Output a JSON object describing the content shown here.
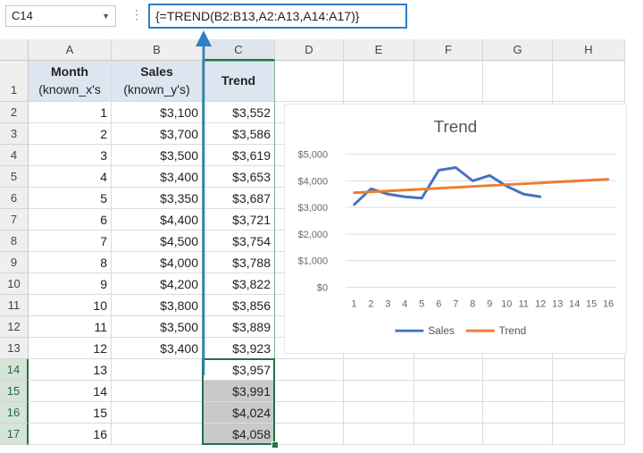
{
  "name_box": {
    "value": "C14"
  },
  "formula_bar": {
    "separator": "⋮",
    "formula": "{=TREND(B2:B13,A2:A13,A14:A17)}"
  },
  "columns": [
    "A",
    "B",
    "C",
    "D",
    "E",
    "F",
    "G",
    "H"
  ],
  "headers": {
    "month": "Month",
    "month_sub": "(known_x's",
    "sales": "Sales",
    "sales_sub": "(known_y's)",
    "trend": "Trend"
  },
  "rows": [
    {
      "row": "2",
      "month": "1",
      "sales": "$3,100",
      "trend": "$3,552"
    },
    {
      "row": "3",
      "month": "2",
      "sales": "$3,700",
      "trend": "$3,586"
    },
    {
      "row": "4",
      "month": "3",
      "sales": "$3,500",
      "trend": "$3,619"
    },
    {
      "row": "5",
      "month": "4",
      "sales": "$3,400",
      "trend": "$3,653"
    },
    {
      "row": "6",
      "month": "5",
      "sales": "$3,350",
      "trend": "$3,687"
    },
    {
      "row": "7",
      "month": "6",
      "sales": "$4,400",
      "trend": "$3,721"
    },
    {
      "row": "8",
      "month": "7",
      "sales": "$4,500",
      "trend": "$3,754"
    },
    {
      "row": "9",
      "month": "8",
      "sales": "$4,000",
      "trend": "$3,788"
    },
    {
      "row": "10",
      "month": "9",
      "sales": "$4,200",
      "trend": "$3,822"
    },
    {
      "row": "11",
      "month": "10",
      "sales": "$3,800",
      "trend": "$3,856"
    },
    {
      "row": "12",
      "month": "11",
      "sales": "$3,500",
      "trend": "$3,889"
    },
    {
      "row": "13",
      "month": "12",
      "sales": "$3,400",
      "trend": "$3,923"
    },
    {
      "row": "14",
      "month": "13",
      "sales": "",
      "trend": "$3,957"
    },
    {
      "row": "15",
      "month": "14",
      "sales": "",
      "trend": "$3,991"
    },
    {
      "row": "16",
      "month": "15",
      "sales": "",
      "trend": "$4,024"
    },
    {
      "row": "17",
      "month": "16",
      "sales": "",
      "trend": "$4,058"
    }
  ],
  "colors": {
    "sales": "#4472c4",
    "trend": "#ed7d31",
    "selection": "#217346",
    "formula_border": "#2f7fc8"
  },
  "chart_data": {
    "type": "line",
    "title": "Trend",
    "x": [
      1,
      2,
      3,
      4,
      5,
      6,
      7,
      8,
      9,
      10,
      11,
      12,
      13,
      14,
      15,
      16
    ],
    "series": [
      {
        "name": "Sales",
        "values": [
          3100,
          3700,
          3500,
          3400,
          3350,
          4400,
          4500,
          4000,
          4200,
          3800,
          3500,
          3400
        ]
      },
      {
        "name": "Trend",
        "values": [
          3552,
          3586,
          3619,
          3653,
          3687,
          3721,
          3754,
          3788,
          3822,
          3856,
          3889,
          3923,
          3957,
          3991,
          4024,
          4058
        ]
      }
    ],
    "ylim": [
      0,
      5000
    ],
    "yticks": [
      "$0",
      "$1,000",
      "$2,000",
      "$3,000",
      "$4,000",
      "$5,000"
    ],
    "ytick_values": [
      0,
      1000,
      2000,
      3000,
      4000,
      5000
    ],
    "grid": true,
    "legend": "bottom"
  }
}
